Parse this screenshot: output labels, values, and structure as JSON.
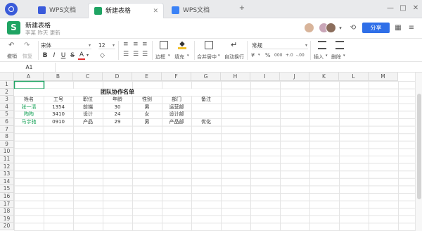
{
  "tabs": [
    {
      "label": "WPS文档",
      "active": false,
      "icon": "wps-doc-icon",
      "color": "#3b5bdb"
    },
    {
      "label": "新建表格",
      "active": true,
      "icon": "sheet-icon",
      "color": "#1fa463"
    },
    {
      "label": "WPS文档",
      "active": false,
      "icon": "doc-icon",
      "color": "#3b82f6"
    }
  ],
  "window": {
    "new_tab": "+",
    "minimize": "—",
    "maximize": "□",
    "close": "✕"
  },
  "document": {
    "title": "新建表格",
    "subtitle": "李某 昨天 更新",
    "logo": "S"
  },
  "header": {
    "share_label": "分享",
    "history_icon": "⟲",
    "grid_icon": "▦",
    "more_icon": "≡"
  },
  "toolbar": {
    "undo_label": "撤销",
    "redo_label": "恢复",
    "font_name": "宋体",
    "font_size": "12",
    "bold": "B",
    "italic": "I",
    "underline": "U",
    "strike": "S",
    "font_color": "A",
    "border_label": "边框",
    "fill_label": "填充",
    "merge_label": "合并居中",
    "wrap_label": "自动换行",
    "number_format": "常规",
    "currency": "¥",
    "percent": "%",
    "thousands": "000",
    "decimal_inc": "+.0",
    "decimal_dec": "-.00",
    "insert_label": "插入",
    "delete_label": "删除"
  },
  "formula": {
    "cell_ref": "A1",
    "value": ""
  },
  "columns": [
    "A",
    "B",
    "C",
    "D",
    "E",
    "F",
    "G",
    "H",
    "I",
    "J",
    "K",
    "L",
    "M"
  ],
  "rows": [
    "1",
    "2",
    "3",
    "4",
    "5",
    "6",
    "7",
    "8",
    "9",
    "10",
    "11",
    "12",
    "13",
    "14",
    "15",
    "16",
    "17",
    "18",
    "19",
    "20"
  ],
  "sheet": {
    "title": "团队协作名单",
    "headers": [
      "姓名",
      "工号",
      "职位",
      "年龄",
      "性别",
      "部门",
      "备注"
    ],
    "records": [
      [
        "张一清",
        "1354",
        "前端",
        "30",
        "男",
        "运营部",
        ""
      ],
      [
        "陶陶",
        "3410",
        "设计",
        "24",
        "女",
        "设计部",
        ""
      ],
      [
        "马宇驰",
        "0910",
        "产品",
        "29",
        "男",
        "产品部",
        "优化"
      ]
    ],
    "name_color": "#1aa35a"
  }
}
